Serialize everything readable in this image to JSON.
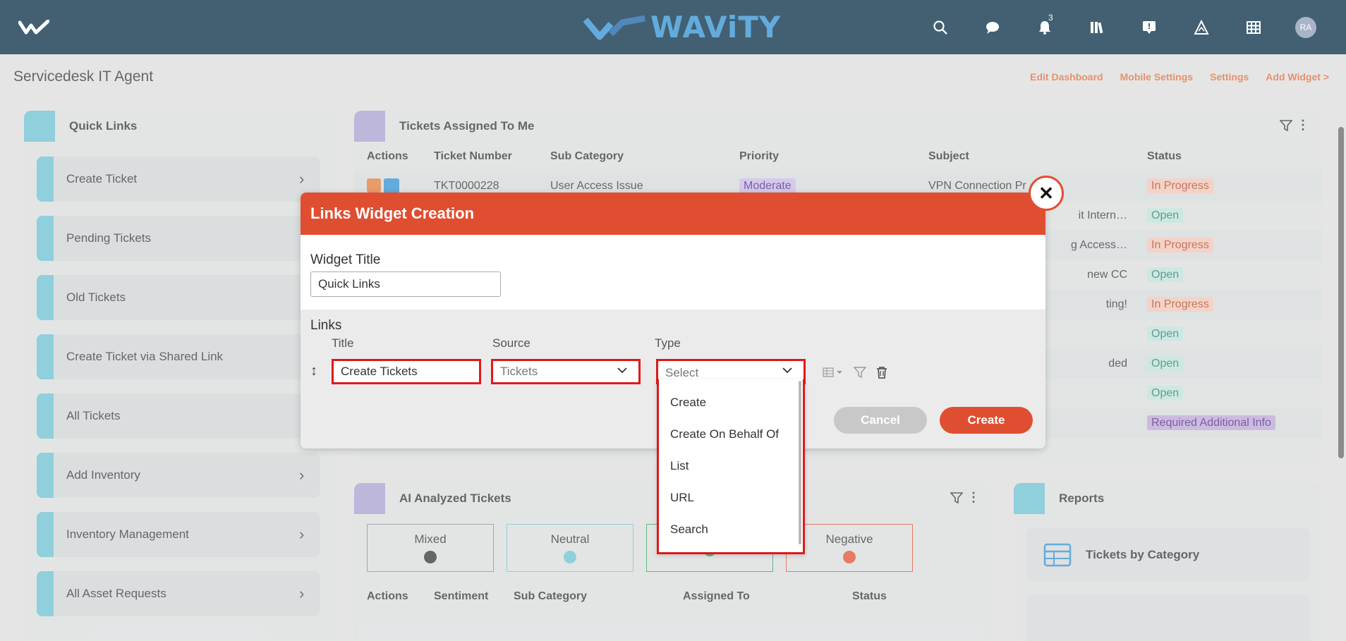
{
  "topbar": {
    "brand": "WAViTY",
    "notification_count": "3",
    "avatar_initials": "RA"
  },
  "page": {
    "title": "Servicedesk IT Agent",
    "links": [
      "Edit Dashboard",
      "Mobile Settings",
      "Settings",
      "Add Widget >"
    ]
  },
  "quick_links": {
    "title": "Quick Links",
    "items": [
      "Create Ticket",
      "Pending Tickets",
      "Old Tickets",
      "Create Ticket via Shared Link",
      "All Tickets",
      "Add Inventory",
      "Inventory Management",
      "All Asset Requests"
    ]
  },
  "tickets": {
    "title": "Tickets Assigned To Me",
    "columns": [
      "Actions",
      "Ticket Number",
      "Sub Category",
      "Priority",
      "Subject",
      "Status"
    ],
    "first_row": {
      "ticket": "TKT0000228",
      "subcat": "User Access Issue",
      "priority": "Moderate",
      "subject": "VPN Connection Pr"
    },
    "subject_fragments": [
      "",
      "it Intern…",
      "g Access…",
      "new CC",
      "ting!",
      "",
      "ded",
      "",
      ""
    ],
    "statuses": [
      "In Progress",
      "Open",
      "In Progress",
      "Open",
      "In Progress",
      "Open",
      "Open",
      "Open",
      "Required Additional Info"
    ]
  },
  "ai": {
    "title": "AI Analyzed Tickets",
    "sentiments": [
      "Mixed",
      "Neutral",
      "",
      "Negative"
    ],
    "columns": [
      "Actions",
      "Sentiment",
      "Sub Category",
      "Assigned To",
      "Status"
    ]
  },
  "reports": {
    "title": "Reports",
    "items": [
      "Tickets by Category"
    ]
  },
  "modal": {
    "title": "Links Widget Creation",
    "widget_title_label": "Widget Title",
    "widget_title_value": "Quick Links",
    "links_label": "Links",
    "col_title": "Title",
    "col_source": "Source",
    "col_type": "Type",
    "title_value": "Create Tickets",
    "source_value": "Tickets",
    "type_placeholder": "Select",
    "cancel": "Cancel",
    "create": "Create",
    "type_options": [
      "Create",
      "Create On Behalf Of",
      "List",
      "URL",
      "Search"
    ]
  }
}
